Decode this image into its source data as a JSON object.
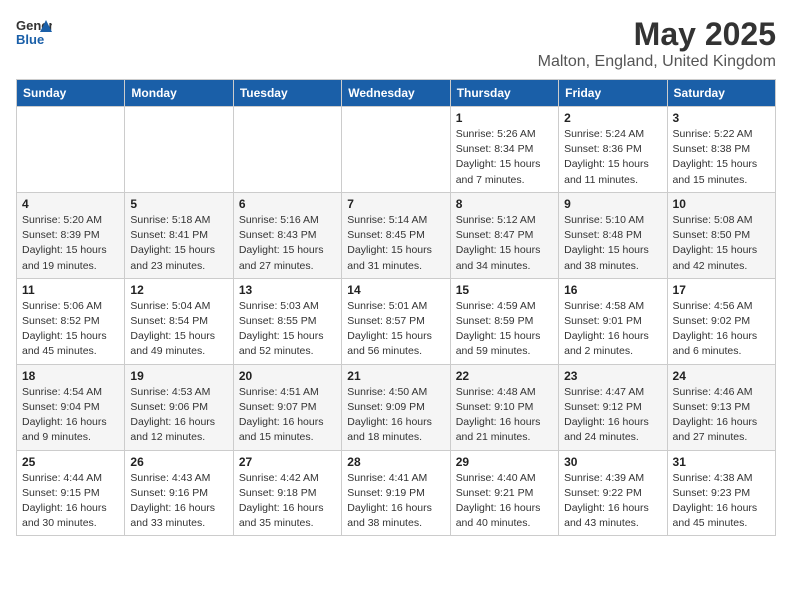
{
  "header": {
    "logo_general": "General",
    "logo_blue": "Blue",
    "month_title": "May 2025",
    "location": "Malton, England, United Kingdom"
  },
  "days_of_week": [
    "Sunday",
    "Monday",
    "Tuesday",
    "Wednesday",
    "Thursday",
    "Friday",
    "Saturday"
  ],
  "weeks": [
    [
      {
        "day": "",
        "info": ""
      },
      {
        "day": "",
        "info": ""
      },
      {
        "day": "",
        "info": ""
      },
      {
        "day": "",
        "info": ""
      },
      {
        "day": "1",
        "info": "Sunrise: 5:26 AM\nSunset: 8:34 PM\nDaylight: 15 hours\nand 7 minutes."
      },
      {
        "day": "2",
        "info": "Sunrise: 5:24 AM\nSunset: 8:36 PM\nDaylight: 15 hours\nand 11 minutes."
      },
      {
        "day": "3",
        "info": "Sunrise: 5:22 AM\nSunset: 8:38 PM\nDaylight: 15 hours\nand 15 minutes."
      }
    ],
    [
      {
        "day": "4",
        "info": "Sunrise: 5:20 AM\nSunset: 8:39 PM\nDaylight: 15 hours\nand 19 minutes."
      },
      {
        "day": "5",
        "info": "Sunrise: 5:18 AM\nSunset: 8:41 PM\nDaylight: 15 hours\nand 23 minutes."
      },
      {
        "day": "6",
        "info": "Sunrise: 5:16 AM\nSunset: 8:43 PM\nDaylight: 15 hours\nand 27 minutes."
      },
      {
        "day": "7",
        "info": "Sunrise: 5:14 AM\nSunset: 8:45 PM\nDaylight: 15 hours\nand 31 minutes."
      },
      {
        "day": "8",
        "info": "Sunrise: 5:12 AM\nSunset: 8:47 PM\nDaylight: 15 hours\nand 34 minutes."
      },
      {
        "day": "9",
        "info": "Sunrise: 5:10 AM\nSunset: 8:48 PM\nDaylight: 15 hours\nand 38 minutes."
      },
      {
        "day": "10",
        "info": "Sunrise: 5:08 AM\nSunset: 8:50 PM\nDaylight: 15 hours\nand 42 minutes."
      }
    ],
    [
      {
        "day": "11",
        "info": "Sunrise: 5:06 AM\nSunset: 8:52 PM\nDaylight: 15 hours\nand 45 minutes."
      },
      {
        "day": "12",
        "info": "Sunrise: 5:04 AM\nSunset: 8:54 PM\nDaylight: 15 hours\nand 49 minutes."
      },
      {
        "day": "13",
        "info": "Sunrise: 5:03 AM\nSunset: 8:55 PM\nDaylight: 15 hours\nand 52 minutes."
      },
      {
        "day": "14",
        "info": "Sunrise: 5:01 AM\nSunset: 8:57 PM\nDaylight: 15 hours\nand 56 minutes."
      },
      {
        "day": "15",
        "info": "Sunrise: 4:59 AM\nSunset: 8:59 PM\nDaylight: 15 hours\nand 59 minutes."
      },
      {
        "day": "16",
        "info": "Sunrise: 4:58 AM\nSunset: 9:01 PM\nDaylight: 16 hours\nand 2 minutes."
      },
      {
        "day": "17",
        "info": "Sunrise: 4:56 AM\nSunset: 9:02 PM\nDaylight: 16 hours\nand 6 minutes."
      }
    ],
    [
      {
        "day": "18",
        "info": "Sunrise: 4:54 AM\nSunset: 9:04 PM\nDaylight: 16 hours\nand 9 minutes."
      },
      {
        "day": "19",
        "info": "Sunrise: 4:53 AM\nSunset: 9:06 PM\nDaylight: 16 hours\nand 12 minutes."
      },
      {
        "day": "20",
        "info": "Sunrise: 4:51 AM\nSunset: 9:07 PM\nDaylight: 16 hours\nand 15 minutes."
      },
      {
        "day": "21",
        "info": "Sunrise: 4:50 AM\nSunset: 9:09 PM\nDaylight: 16 hours\nand 18 minutes."
      },
      {
        "day": "22",
        "info": "Sunrise: 4:48 AM\nSunset: 9:10 PM\nDaylight: 16 hours\nand 21 minutes."
      },
      {
        "day": "23",
        "info": "Sunrise: 4:47 AM\nSunset: 9:12 PM\nDaylight: 16 hours\nand 24 minutes."
      },
      {
        "day": "24",
        "info": "Sunrise: 4:46 AM\nSunset: 9:13 PM\nDaylight: 16 hours\nand 27 minutes."
      }
    ],
    [
      {
        "day": "25",
        "info": "Sunrise: 4:44 AM\nSunset: 9:15 PM\nDaylight: 16 hours\nand 30 minutes."
      },
      {
        "day": "26",
        "info": "Sunrise: 4:43 AM\nSunset: 9:16 PM\nDaylight: 16 hours\nand 33 minutes."
      },
      {
        "day": "27",
        "info": "Sunrise: 4:42 AM\nSunset: 9:18 PM\nDaylight: 16 hours\nand 35 minutes."
      },
      {
        "day": "28",
        "info": "Sunrise: 4:41 AM\nSunset: 9:19 PM\nDaylight: 16 hours\nand 38 minutes."
      },
      {
        "day": "29",
        "info": "Sunrise: 4:40 AM\nSunset: 9:21 PM\nDaylight: 16 hours\nand 40 minutes."
      },
      {
        "day": "30",
        "info": "Sunrise: 4:39 AM\nSunset: 9:22 PM\nDaylight: 16 hours\nand 43 minutes."
      },
      {
        "day": "31",
        "info": "Sunrise: 4:38 AM\nSunset: 9:23 PM\nDaylight: 16 hours\nand 45 minutes."
      }
    ]
  ]
}
